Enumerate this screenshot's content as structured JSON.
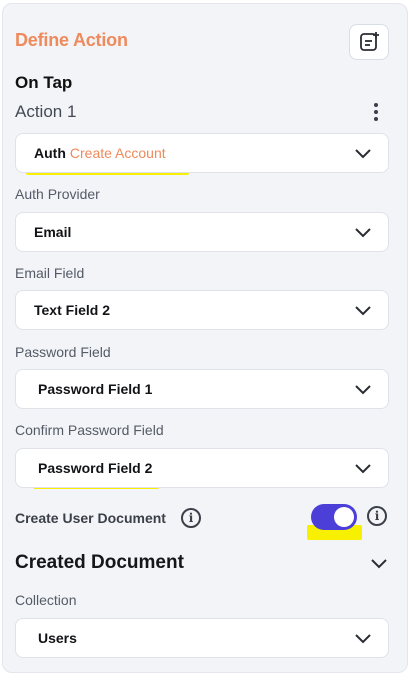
{
  "header": {
    "title": "Define Action",
    "icon": "clipboard-add-icon"
  },
  "trigger": {
    "label": "On Tap"
  },
  "action": {
    "label": "Action 1",
    "menu_icon": "more-vertical-icon"
  },
  "auth_action": {
    "prefix": "Auth",
    "value": "Create Account"
  },
  "auth_provider": {
    "label": "Auth Provider",
    "value": "Email"
  },
  "email_field": {
    "label": "Email Field",
    "value": "Text Field 2"
  },
  "password_field": {
    "label": "Password Field",
    "value": "Password Field 1"
  },
  "confirm_password_field": {
    "label": "Confirm Password Field",
    "value": "Password Field 2"
  },
  "create_user_document": {
    "label": "Create User Document",
    "enabled": true,
    "info_icon": "info-icon"
  },
  "created_document": {
    "title": "Created Document"
  },
  "collection": {
    "label": "Collection",
    "value": "Users"
  },
  "colors": {
    "accent": "#ee8a5c",
    "toggle": "#4b3fd8",
    "highlight": "#f7f000",
    "panel": "#f2f4f8"
  }
}
